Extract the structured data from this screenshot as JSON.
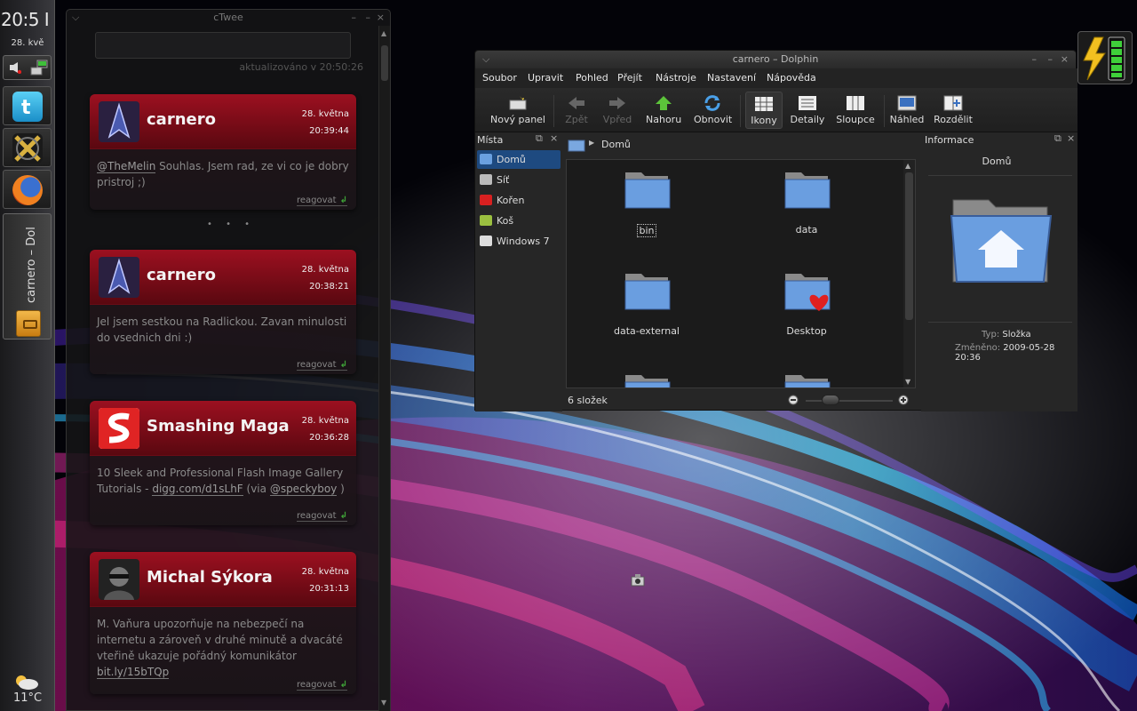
{
  "panel": {
    "clock": "20:5 I",
    "date": "28. kvě",
    "task_label": "carnero – Dol",
    "temperature": "11°C",
    "launchers": [
      "twitter-icon",
      "xchat-icon",
      "firefox-icon"
    ]
  },
  "ctwee": {
    "title": "cTwee",
    "updated": "aktualizováno v 20:50:26",
    "more_dots": "• • •",
    "reply_label": "reagovat",
    "tweets": [
      {
        "user": "carnero",
        "date": "28. května",
        "time": "20:39:44",
        "mention": "@TheMelin",
        "text": " Souhlas. Jsem rad, ze vi co je dobry pristroj ;)"
      },
      {
        "user": "carnero",
        "date": "28. května",
        "time": "20:38:21",
        "text": "Jel jsem sestkou na Radlickou. Zavan minulosti do vsednich dni :)"
      },
      {
        "user": "Smashing Magazir",
        "date": "28. května",
        "time": "20:36:28",
        "text1": "10 Sleek and Professional Flash Image Gallery Tutorials - ",
        "link1": "digg.com/d1sLhF",
        "text2": " (via ",
        "link2": "@speckyboy",
        "text3": " )"
      },
      {
        "user": "Michal Sýkora",
        "date": "28. května",
        "time": "20:31:13",
        "text1": "M. Vaňura upozorňuje na nebezpečí na internetu a zároveň v druhé minutě a dvacáté vteřině ukazuje pořádný komunikátor ",
        "link1": "bit.ly/15bTQp"
      }
    ]
  },
  "dolphin": {
    "title": "carnero – Dolphin",
    "menu": [
      "Soubor",
      "Upravit",
      "Pohled",
      "Přejít",
      "Nástroje",
      "Nastavení",
      "Nápověda"
    ],
    "toolbar": {
      "new_panel": "Nový panel",
      "back": "Zpět",
      "forward": "Vpřed",
      "up": "Nahoru",
      "reload": "Obnovit",
      "icons": "Ikony",
      "details": "Detaily",
      "columns": "Sloupce",
      "preview": "Náhled",
      "split": "Rozdělit"
    },
    "places": {
      "title": "Místa",
      "items": [
        "Domů",
        "Síť",
        "Kořen",
        "Koš",
        "Windows 7"
      ]
    },
    "breadcrumb": "Domů",
    "files": [
      "bin",
      "data",
      "data-external",
      "Desktop"
    ],
    "status": "6 složek",
    "info": {
      "title": "Informace",
      "name": "Domů",
      "type_label": "Typ:",
      "type_value": "Složka",
      "modified_label": "Změněno:",
      "modified_value": "2009-05-28 20:36"
    }
  },
  "colors": {
    "tweet_header": "#9c1020",
    "selection": "#1e4a80",
    "reply_arrow": "#3fa538"
  }
}
